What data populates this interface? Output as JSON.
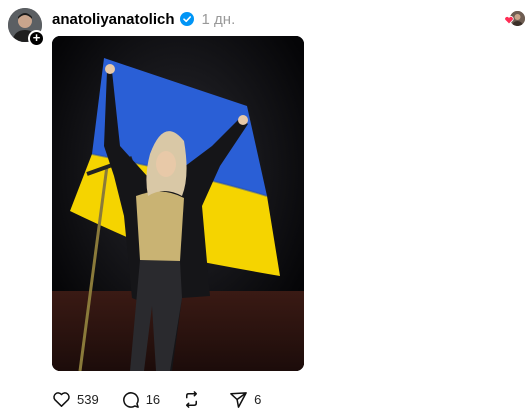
{
  "post": {
    "username": "anatoliyanatolich",
    "time_ago": "1 дн.",
    "verified": true
  },
  "avatar": {
    "icon": "user-avatar",
    "follow_badge": "+"
  },
  "liked_by": {
    "icon": "heart-icon",
    "color": "#ff2d55"
  },
  "media": {
    "description_icon": "photo"
  },
  "actions": {
    "likes": "539",
    "comments": "16",
    "reposts": "",
    "shares": "6"
  },
  "colors": {
    "verified_blue": "#0095f6",
    "flag_blue": "#2a5fd6",
    "flag_yellow": "#f5d400",
    "muted_text": "#999999"
  }
}
